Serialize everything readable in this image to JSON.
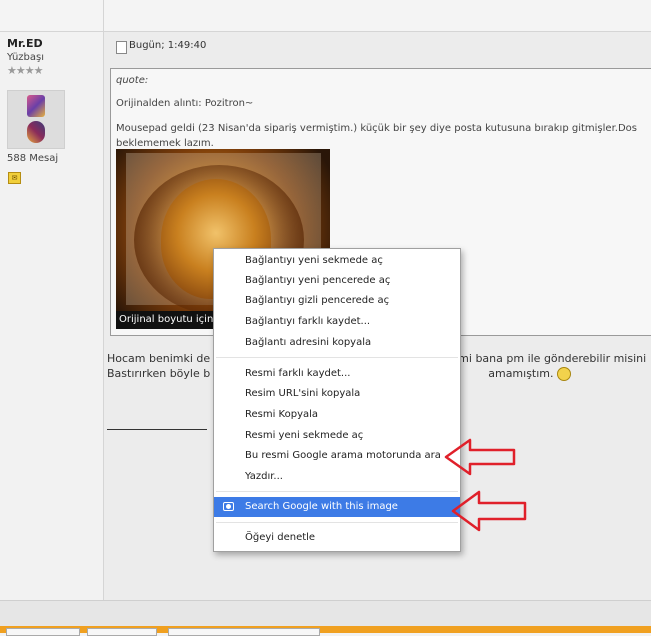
{
  "user": {
    "name": "Mr.ED",
    "rank": "Yüzbaşı",
    "stars": "★★★★",
    "post_count": "588 Mesaj"
  },
  "post": {
    "date": "Bugün; 1:49:40"
  },
  "quote": {
    "label": "quote:",
    "source": "Orijinalden alıntı: Pozitron~",
    "line1": "Mousepad geldi (23 Nisan'da sipariş vermiştim.) küçük bir şey diye posta kutusuna bırakıp gitmişler.Dos",
    "line2": "beklememek lazım.",
    "image_caption": "Orijinal boyutu için t"
  },
  "reply": {
    "line1": "Hocam benimki de",
    "line1_tail": "mi bana pm ile gönderebilir misini",
    "line2": "Bastırırken böyle b",
    "line2_tail": "amamıştım."
  },
  "context_menu": {
    "items": [
      "Bağlantıyı yeni sekmede aç",
      "Bağlantıyı yeni pencerede aç",
      "Bağlantıyı gizli pencerede aç",
      "Bağlantıyı farklı kaydet...",
      "Bağlantı adresini kopyala",
      "Resmi farklı kaydet...",
      "Resim URL'sini kopyala",
      "Resmi Kopyala",
      "Resmi yeni sekmede aç",
      "Bu resmi Google arama motorunda ara",
      "Yazdır...",
      "Search Google with this image",
      "Öğeyi denetle"
    ]
  },
  "colors": {
    "highlight": "#3d7be6",
    "arrow": "#e0202a",
    "footer_bar": "#f0a020"
  },
  "icons": {
    "pm": "pm-icon",
    "post": "post-icon",
    "camera": "camera-icon",
    "smiley": "smiley-icon"
  }
}
